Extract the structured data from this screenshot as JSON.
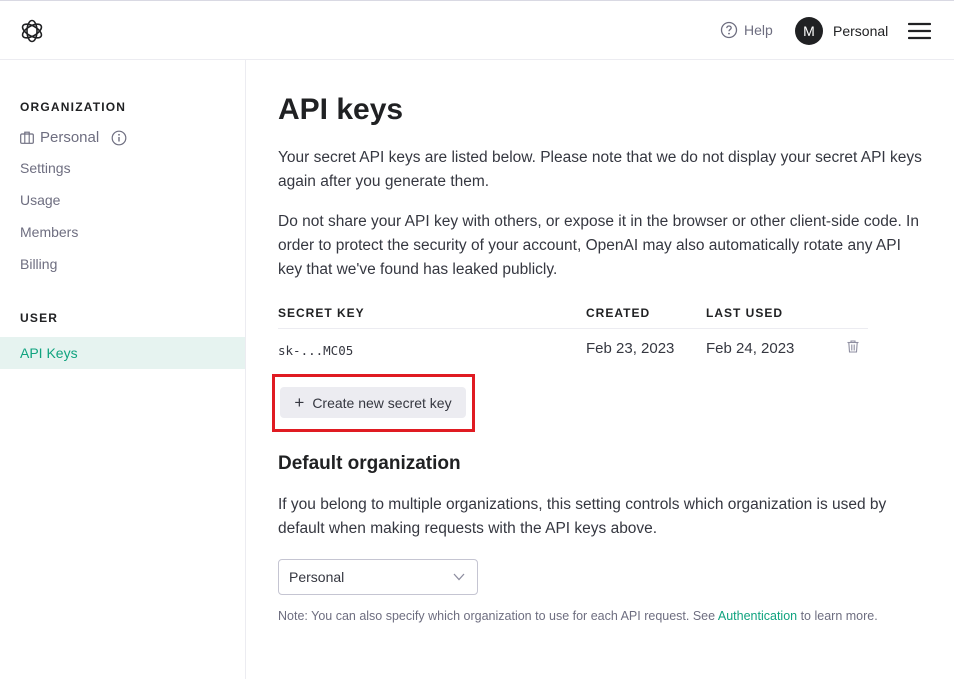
{
  "header": {
    "help_label": "Help",
    "avatar_initial": "M",
    "account_label": "Personal"
  },
  "sidebar": {
    "org_heading": "ORGANIZATION",
    "org_name": "Personal",
    "items": [
      "Settings",
      "Usage",
      "Members",
      "Billing"
    ],
    "user_heading": "USER",
    "active_item": "API Keys"
  },
  "main": {
    "title": "API keys",
    "para1": "Your secret API keys are listed below. Please note that we do not display your secret API keys again after you generate them.",
    "para2": "Do not share your API key with others, or expose it in the browser or other client-side code. In order to protect the security of your account, OpenAI may also automatically rotate any API key that we've found has leaked publicly.",
    "table": {
      "headers": [
        "SECRET KEY",
        "CREATED",
        "LAST USED"
      ],
      "rows": [
        {
          "key": "sk-...MC05",
          "created": "Feb 23, 2023",
          "last_used": "Feb 24, 2023"
        }
      ]
    },
    "create_button": "Create new secret key",
    "default_org_title": "Default organization",
    "default_org_text": "If you belong to multiple organizations, this setting controls which organization is used by default when making requests with the API keys above.",
    "org_select_value": "Personal",
    "note_prefix": "Note: You can also specify which organization to use for each API request. See ",
    "note_link": "Authentication",
    "note_suffix": " to learn more."
  },
  "colors": {
    "accent": "#10a37f",
    "active_bg": "#e6f3f0",
    "highlight": "#e01b22"
  }
}
